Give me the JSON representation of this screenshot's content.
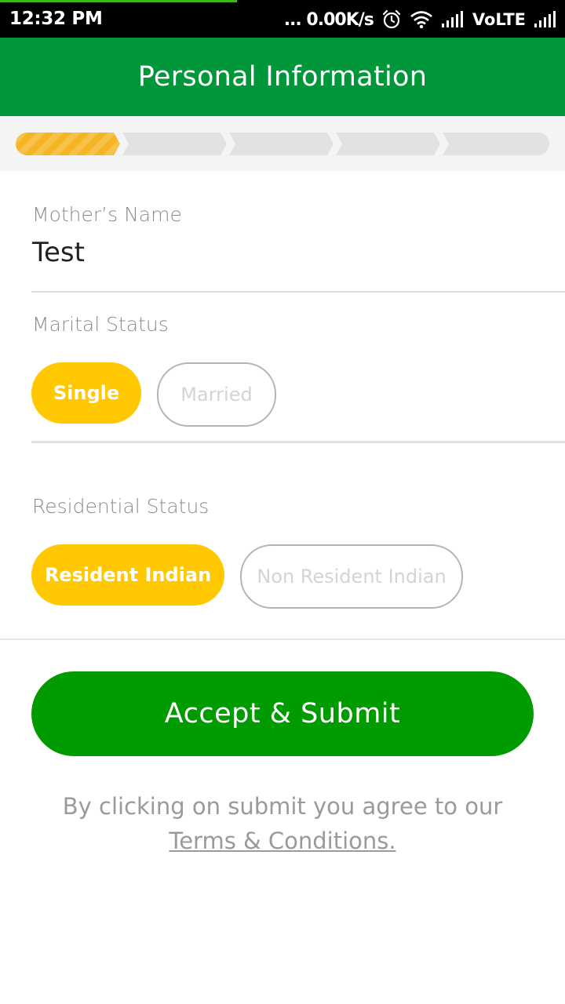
{
  "status_bar": {
    "time": "12:32 PM",
    "network_speed": "... 0.00K/s",
    "network_type": "VoLTE",
    "icons": [
      "alarm-icon",
      "wifi-icon",
      "signal-icon",
      "signal-icon"
    ]
  },
  "header": {
    "title": "Personal Information"
  },
  "stepper": {
    "total_steps": 5,
    "current_step": 1,
    "active_color": "#f5b523",
    "inactive_color": "#e2e2e2"
  },
  "form": {
    "mothers_name": {
      "label": "Mother’s Name",
      "value": "Test"
    },
    "marital_status": {
      "label": "Marital Status",
      "options": [
        "Single",
        "Married"
      ],
      "selected": "Single"
    },
    "residential_status": {
      "label": "Residential Status",
      "options": [
        "Resident Indian",
        "Non Resident Indian"
      ],
      "selected": "Resident Indian"
    }
  },
  "actions": {
    "submit_label": "Accept & Submit",
    "terms_prefix": "By clicking on submit you agree to our",
    "terms_link": "Terms & Conditions."
  },
  "colors": {
    "brand_green": "#00963a",
    "button_green": "#009b00",
    "accent_yellow": "#ffc800"
  }
}
